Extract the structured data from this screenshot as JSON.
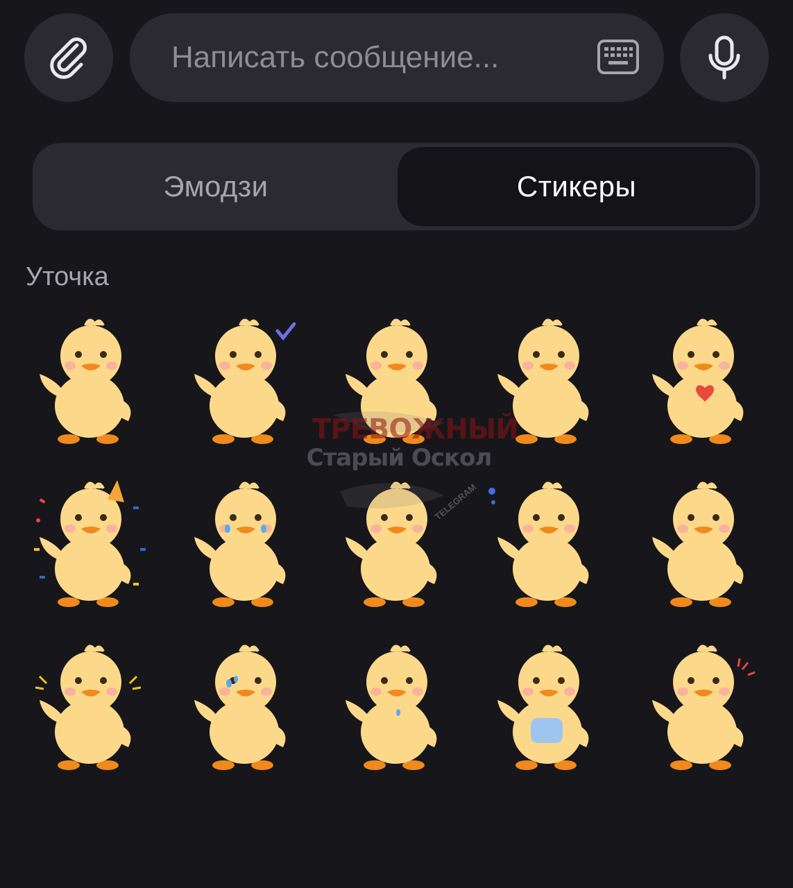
{
  "composer": {
    "placeholder": "Написать сообщение...",
    "attach_icon": "paperclip-icon",
    "keyboard_icon": "keyboard-icon",
    "mic_icon": "microphone-icon"
  },
  "tabs": [
    {
      "label": "Эмодзи",
      "selected": false
    },
    {
      "label": "Стикеры",
      "selected": true
    }
  ],
  "sticker_pack": {
    "title": "Уточка",
    "stickers": [
      {
        "name": "duck-waving"
      },
      {
        "name": "duck-checkmark"
      },
      {
        "name": "duck-giggling"
      },
      {
        "name": "duck-arms-open"
      },
      {
        "name": "duck-heart"
      },
      {
        "name": "duck-party"
      },
      {
        "name": "duck-laughing-tears"
      },
      {
        "name": "duck-thinking"
      },
      {
        "name": "duck-pondering"
      },
      {
        "name": "duck-suspicious"
      },
      {
        "name": "duck-surprised"
      },
      {
        "name": "duck-nervous"
      },
      {
        "name": "duck-sad"
      },
      {
        "name": "duck-upset-holding"
      },
      {
        "name": "duck-angry"
      }
    ]
  },
  "watermark": {
    "line1": "ТРЕВОЖНЫЙ",
    "line2": "Старый Оскол",
    "line3": "TELEGRAM"
  },
  "colors": {
    "background": "#17161b",
    "surface": "#2b2a31",
    "selected_tab": "#141317",
    "duck_body": "#fcd98a",
    "duck_beak": "#f08a1c"
  }
}
